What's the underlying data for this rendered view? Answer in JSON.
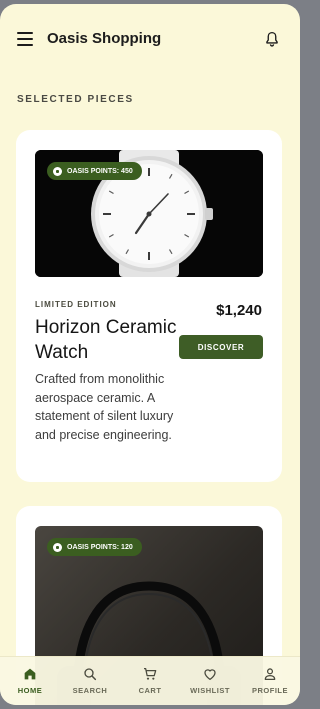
{
  "app": {
    "title": "Oasis Shopping"
  },
  "section": {
    "title": "SELECTED PIECES"
  },
  "products": [
    {
      "points": "OASIS POINTS: 450",
      "edition": "LIMITED EDITION",
      "name": "Horizon Ceramic Watch",
      "price": "$1,240",
      "cta": "DISCOVER",
      "description": "Crafted from monolithic aerospace ceramic. A statement of silent luxury and precise engineering.",
      "image": "white-ceramic-watch"
    },
    {
      "points": "OASIS POINTS: 120",
      "image": "black-headphones"
    }
  ],
  "nav": {
    "items": [
      {
        "label": "HOME",
        "icon": "home-icon",
        "active": true
      },
      {
        "label": "SEARCH",
        "icon": "search-icon",
        "active": false
      },
      {
        "label": "CART",
        "icon": "cart-icon",
        "active": false
      },
      {
        "label": "WISHLIST",
        "icon": "heart-icon",
        "active": false
      },
      {
        "label": "PROFILE",
        "icon": "person-icon",
        "active": false
      }
    ]
  },
  "colors": {
    "accent": "#3b5e20",
    "background": "#fbf8d9",
    "card": "#ffffff"
  }
}
